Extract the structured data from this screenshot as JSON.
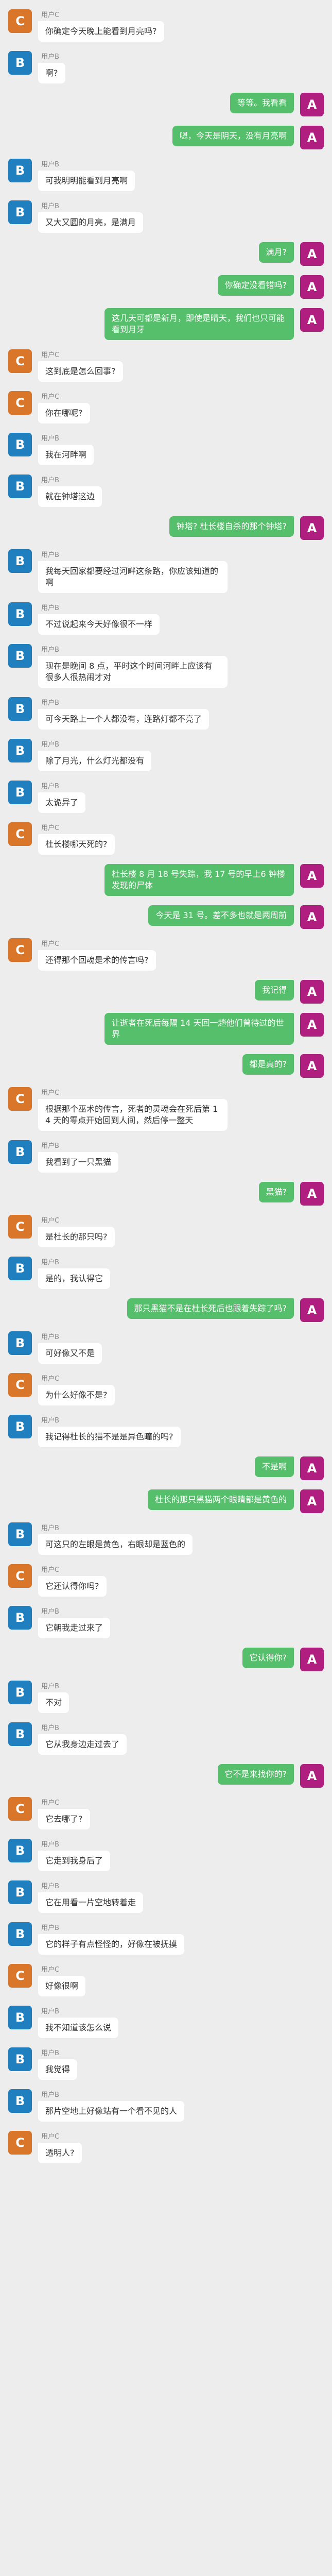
{
  "colors": {
    "page_bg": "#ededed",
    "bubble_user": "#56bf6b",
    "bubble_other": "#ffffff"
  },
  "avatars": {
    "C": {
      "letter": "C",
      "color": "#d9762a",
      "icon": "avatar-c"
    },
    "B": {
      "letter": "B",
      "color": "#1f7fbf",
      "icon": "avatar-b"
    },
    "A": {
      "letter": "A",
      "color": "#b01e7f",
      "icon": "avatar-a"
    }
  },
  "messages": [
    {
      "side": "left",
      "avatar": "C",
      "name": "用户C",
      "text": "你确定今天晚上能看到月亮吗?"
    },
    {
      "side": "left",
      "avatar": "B",
      "name": "用户B",
      "text": "啊?"
    },
    {
      "side": "right",
      "avatar": "A",
      "name": "",
      "text": "等等。我看看"
    },
    {
      "side": "right",
      "avatar": "A",
      "name": "",
      "text": "嗯，今天是阴天，没有月亮啊"
    },
    {
      "side": "left",
      "avatar": "B",
      "name": "用户B",
      "text": "可我明明能看到月亮啊"
    },
    {
      "side": "left",
      "avatar": "B",
      "name": "用户B",
      "text": "又大又圆的月亮，是满月"
    },
    {
      "side": "right",
      "avatar": "A",
      "name": "",
      "text": "满月?"
    },
    {
      "side": "right",
      "avatar": "A",
      "name": "",
      "text": "你确定没看错吗?"
    },
    {
      "side": "right",
      "avatar": "A",
      "name": "",
      "text": "这几天可都是新月，即使是晴天，我们也只可能看到月牙"
    },
    {
      "side": "left",
      "avatar": "C",
      "name": "用户C",
      "text": "这到底是怎么回事?"
    },
    {
      "side": "left",
      "avatar": "C",
      "name": "用户C",
      "text": "你在哪呢?"
    },
    {
      "side": "left",
      "avatar": "B",
      "name": "用户B",
      "text": "我在河畔啊"
    },
    {
      "side": "left",
      "avatar": "B",
      "name": "用户B",
      "text": "就在钟塔这边"
    },
    {
      "side": "right",
      "avatar": "A",
      "name": "",
      "text": "钟塔? 杜长楼自杀的那个钟塔?"
    },
    {
      "side": "left",
      "avatar": "B",
      "name": "用户B",
      "text": "我每天回家都要经过河畔这条路，你应该知道的啊"
    },
    {
      "side": "left",
      "avatar": "B",
      "name": "用户B",
      "text": "不过说起来今天好像很不一样"
    },
    {
      "side": "left",
      "avatar": "B",
      "name": "用户B",
      "text": "现在是晚间 8 点，平时这个时间河畔上应该有很多人很热闹才对"
    },
    {
      "side": "left",
      "avatar": "B",
      "name": "用户B",
      "text": "可今天路上一个人都没有，连路灯都不亮了"
    },
    {
      "side": "left",
      "avatar": "B",
      "name": "用户B",
      "text": "除了月光，什么灯光都没有"
    },
    {
      "side": "left",
      "avatar": "B",
      "name": "用户B",
      "text": "太诡异了"
    },
    {
      "side": "left",
      "avatar": "C",
      "name": "用户C",
      "text": "杜长楼哪天死的?"
    },
    {
      "side": "right",
      "avatar": "A",
      "name": "",
      "text": "杜长楼 8 月 18 号失踪，我 17 号的早上6 钟楼发现的尸体"
    },
    {
      "side": "right",
      "avatar": "A",
      "name": "",
      "text": "今天是 31 号。差不多也就是两周前"
    },
    {
      "side": "left",
      "avatar": "C",
      "name": "用户C",
      "text": "还得那个回魂是术的传言吗?"
    },
    {
      "side": "right",
      "avatar": "A",
      "name": "",
      "text": "我记得"
    },
    {
      "side": "right",
      "avatar": "A",
      "name": "",
      "text": "让逝者在死后每隔 14 天回一趟他们曾待过的世界"
    },
    {
      "side": "right",
      "avatar": "A",
      "name": "",
      "text": "都是真的?"
    },
    {
      "side": "left",
      "avatar": "C",
      "name": "用户C",
      "text": "根据那个巫术的传言，死者的灵魂会在死后第 14 天的零点开始回到人间，然后停一整天"
    },
    {
      "side": "left",
      "avatar": "B",
      "name": "用户B",
      "text": "我看到了一只黑猫"
    },
    {
      "side": "right",
      "avatar": "A",
      "name": "",
      "text": "黑猫?"
    },
    {
      "side": "left",
      "avatar": "C",
      "name": "用户C",
      "text": "是杜长的那只吗?"
    },
    {
      "side": "left",
      "avatar": "B",
      "name": "用户B",
      "text": "是的，我认得它"
    },
    {
      "side": "right",
      "avatar": "A",
      "name": "",
      "text": "那只黑猫不是在杜长死后也跟着失踪了吗?"
    },
    {
      "side": "left",
      "avatar": "B",
      "name": "用户B",
      "text": "可好像又不是"
    },
    {
      "side": "left",
      "avatar": "C",
      "name": "用户C",
      "text": "为什么好像不是?"
    },
    {
      "side": "left",
      "avatar": "B",
      "name": "用户B",
      "text": "我记得杜长的猫不是是异色瞳的吗?"
    },
    {
      "side": "right",
      "avatar": "A",
      "name": "",
      "text": "不是啊"
    },
    {
      "side": "right",
      "avatar": "A",
      "name": "",
      "text": "杜长的那只黑猫两个眼睛都是黄色的"
    },
    {
      "side": "left",
      "avatar": "B",
      "name": "用户B",
      "text": "可这只的左眼是黄色，右眼却是蓝色的"
    },
    {
      "side": "left",
      "avatar": "C",
      "name": "用户C",
      "text": "它还认得你吗?"
    },
    {
      "side": "left",
      "avatar": "B",
      "name": "用户B",
      "text": "它朝我走过来了"
    },
    {
      "side": "right",
      "avatar": "A",
      "name": "",
      "text": "它认得你?"
    },
    {
      "side": "left",
      "avatar": "B",
      "name": "用户B",
      "text": "不对"
    },
    {
      "side": "left",
      "avatar": "B",
      "name": "用户B",
      "text": "它从我身边走过去了"
    },
    {
      "side": "right",
      "avatar": "A",
      "name": "",
      "text": "它不是来找你的?"
    },
    {
      "side": "left",
      "avatar": "C",
      "name": "用户C",
      "text": "它去哪了?"
    },
    {
      "side": "left",
      "avatar": "B",
      "name": "用户B",
      "text": "它走到我身后了"
    },
    {
      "side": "left",
      "avatar": "B",
      "name": "用户B",
      "text": "它在用看一片空地转着走"
    },
    {
      "side": "left",
      "avatar": "B",
      "name": "用户B",
      "text": "它的样子有点怪怪的，好像在被抚摸"
    },
    {
      "side": "left",
      "avatar": "C",
      "name": "用户C",
      "text": "好像很啊"
    },
    {
      "side": "left",
      "avatar": "B",
      "name": "用户B",
      "text": "我不知道该怎么说"
    },
    {
      "side": "left",
      "avatar": "B",
      "name": "用户B",
      "text": "我觉得"
    },
    {
      "side": "left",
      "avatar": "B",
      "name": "用户B",
      "text": "那片空地上好像站有一个看不见的人"
    },
    {
      "side": "left",
      "avatar": "C",
      "name": "用户C",
      "text": "透明人?"
    }
  ]
}
